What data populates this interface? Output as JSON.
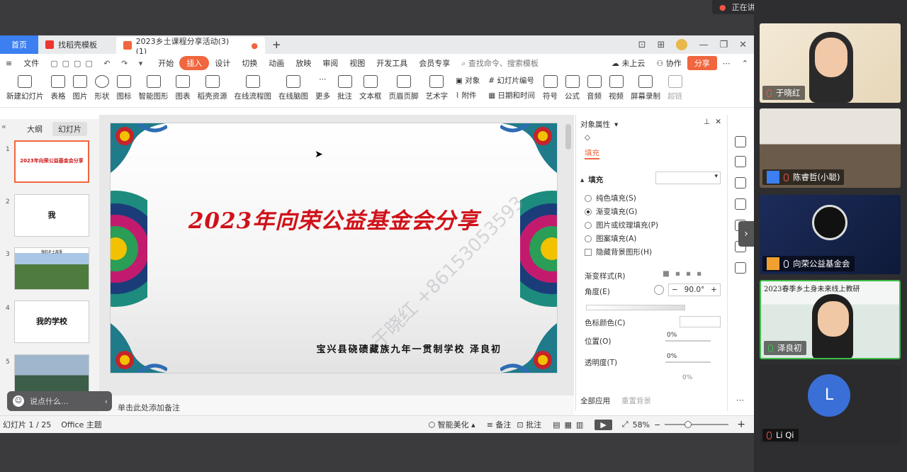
{
  "meeting": {
    "speaking_label": "正在讲话：泽良初; 向荣公益基...",
    "chat_placeholder": "说点什么..."
  },
  "tabs": {
    "home": "首页",
    "template": "找稻壳模板",
    "document": "2023乡土课程分享活动(3)(1)",
    "add": "+"
  },
  "menu": {
    "file": "文件",
    "items": [
      "开始",
      "插入",
      "设计",
      "切换",
      "动画",
      "放映",
      "审阅",
      "视图",
      "开发工具",
      "会员专享"
    ],
    "selected": "插入",
    "search_placeholder": "查找命令、搜索模板",
    "cloud": "未上云",
    "collab": "协作",
    "share": "分享"
  },
  "ribbon": {
    "buttons": [
      "新建幻灯片",
      "表格",
      "图片",
      "形状",
      "图标",
      "智能图形",
      "图表",
      "稻壳资源",
      "在线流程图",
      "在线脑图",
      "更多",
      "批注",
      "文本框",
      "页眉页脚",
      "艺术字"
    ],
    "small_top": "对象",
    "small_bottom": "附件",
    "small2_top": "幻灯片编号",
    "small2_bottom": "日期和时间",
    "buttons2": [
      "符号",
      "公式",
      "音频",
      "视频",
      "屏幕录制",
      "超链"
    ]
  },
  "left_panel": {
    "tab_outline": "大纲",
    "tab_slides": "幻灯片",
    "thumbs": [
      {
        "num": "1",
        "text": "2023年向荣公益基金会分享"
      },
      {
        "num": "2",
        "text": "我"
      },
      {
        "num": "3",
        "text": "我的乡土故事"
      },
      {
        "num": "4",
        "text": "我的学校"
      },
      {
        "num": "5",
        "text": ""
      }
    ]
  },
  "slide": {
    "title": "2023年向荣公益基金会分享",
    "subtitle": "宝兴县硗碛藏族九年一贯制学校  泽良初",
    "watermark": "于晓红 +86153053593"
  },
  "notes_placeholder": "单击此处添加备注",
  "props": {
    "header": "对象属性",
    "tab_fill": "填充",
    "section_fill": "填充",
    "options": [
      "纯色填充(S)",
      "渐变填充(G)",
      "图片或纹理填充(P)",
      "图案填充(A)"
    ],
    "selected_option": "渐变填充(G)",
    "hide_bg": "隐藏背景图形(H)",
    "gradient_style": "渐变样式(R)",
    "angle_label": "角度(E)",
    "angle_value": "90.0°",
    "color_label": "色标颜色(C)",
    "position_label": "位置(O)",
    "position_value": "0%",
    "transparency_label": "透明度(T)",
    "transparency_value": "0%",
    "brightness_value": "0%",
    "apply_all": "全部应用",
    "reset_bg": "重置背景"
  },
  "status": {
    "slide_count": "幻灯片 1 / 25",
    "theme": "Office 主题",
    "beautify": "智能美化",
    "notes": "备注",
    "comments": "批注",
    "zoom": "58%",
    "minus": "−",
    "plus": "+"
  },
  "participants": [
    {
      "name": "于晓红"
    },
    {
      "name": "陈睿哲(小聪)"
    },
    {
      "name": "向荣公益基金会"
    },
    {
      "name": "泽良初",
      "banner": "2023春季乡土身未来线上教研"
    },
    {
      "name": "Li Qi",
      "initial": "L"
    }
  ],
  "colors": {
    "accent": "#f0663e",
    "wps_blue": "#3b7ff0",
    "title_red": "#d0121a",
    "active_speaker": "#3fbd4a"
  }
}
